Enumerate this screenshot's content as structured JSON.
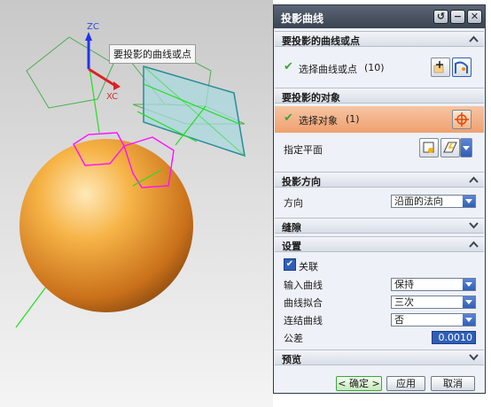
{
  "viewport": {
    "tooltip": "要投影的曲线或点",
    "axis_zc": "ZC",
    "axis_xc": "XC"
  },
  "dialog": {
    "title": "投影曲线",
    "titlebar_buttons": [
      "reset-icon",
      "minimize-icon",
      "close-icon"
    ],
    "sections": {
      "curves": {
        "header": "要投影的曲线或点",
        "select_label": "选择曲线或点",
        "select_count": "(10)"
      },
      "objects": {
        "header": "要投影的对象",
        "select_label": "选择对象",
        "select_count": "(1)",
        "plane_label": "指定平面"
      },
      "direction": {
        "header": "投影方向",
        "direction_label": "方向",
        "direction_value": "沿面的法向"
      },
      "gap": {
        "header": "缝隙"
      },
      "settings": {
        "header": "设置",
        "associative_label": "关联",
        "associative_checked": true,
        "input_curves_label": "输入曲线",
        "input_curves_value": "保持",
        "curve_fit_label": "曲线拟合",
        "curve_fit_value": "三次",
        "join_curves_label": "连结曲线",
        "join_curves_value": "否",
        "tolerance_label": "公差",
        "tolerance_value": "0.0010"
      },
      "preview": {
        "header": "预览"
      }
    },
    "buttons": {
      "ok": "< 确定 >",
      "apply": "应用",
      "cancel": "取消"
    }
  },
  "colors": {
    "titlebar": "#3b4452",
    "highlight_row": "#f0a070",
    "sphere": "#f0a030",
    "plane_fill": "#a8d8dc",
    "projected_curve": "#ff00ff",
    "accent_select": "#2f5fb8"
  }
}
